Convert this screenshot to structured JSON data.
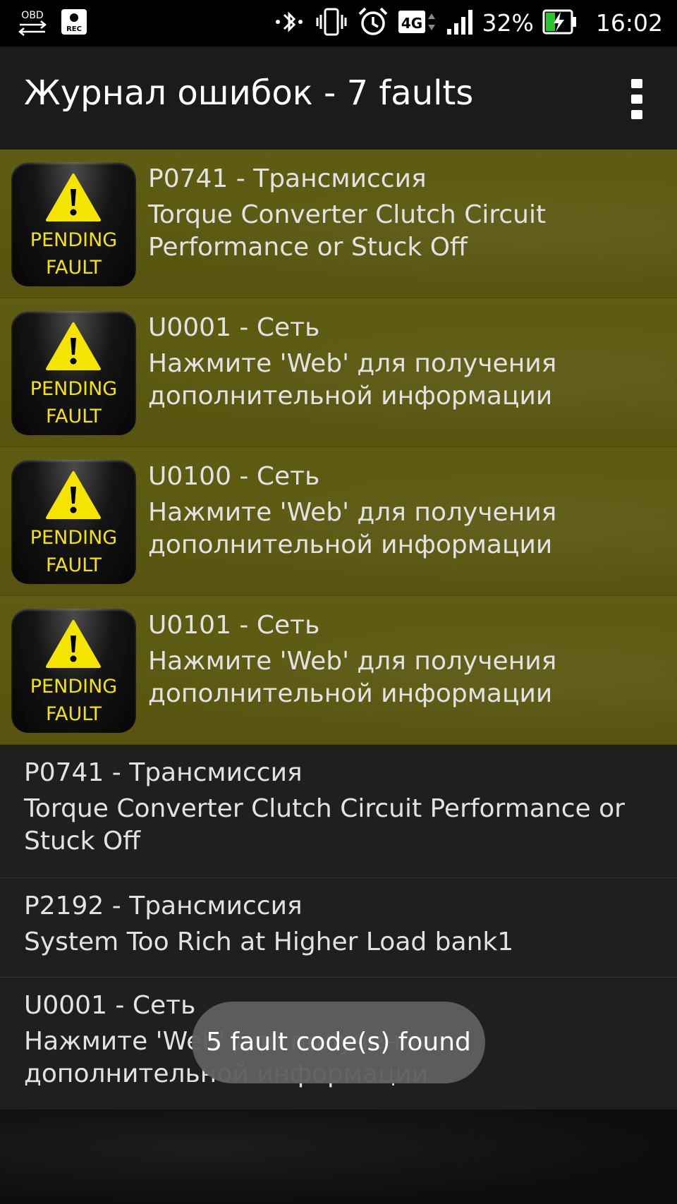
{
  "status_bar": {
    "obd_label": "OBD",
    "rec_label": "REC",
    "network": "4G",
    "battery": "32%",
    "time": "16:02"
  },
  "action_bar": {
    "title": "Журнал ошибок - 7 faults"
  },
  "badge": {
    "line1": "PENDING",
    "line2": "FAULT"
  },
  "pending_faults": [
    {
      "code": "P0741 - Трансмиссия",
      "description": "Torque Converter Clutch Circuit Performance or Stuck Off"
    },
    {
      "code": "U0001 - Сеть",
      "description": "Нажмите 'Web' для получения дополнительной информации"
    },
    {
      "code": "U0100 - Сеть",
      "description": "Нажмите 'Web' для получения дополнительной информации"
    },
    {
      "code": "U0101 - Сеть",
      "description": "Нажмите 'Web' для получения дополнительной информации"
    }
  ],
  "stored_faults": [
    {
      "code": "P0741 - Трансмиссия",
      "description": "Torque Converter Clutch Circuit Performance or Stuck Off"
    },
    {
      "code": "P2192 - Трансмиссия",
      "description": "System Too Rich at Higher Load bank1"
    },
    {
      "code": "U0001 - Сеть",
      "description": "Нажмите 'Web' для получения дополнительной информации"
    }
  ],
  "toast": {
    "message": "5 fault code(s) found"
  },
  "colors": {
    "pending_row": "#5f5c13",
    "badge_yellow": "#f5e400",
    "toast_bg": "#5f5f5f"
  }
}
